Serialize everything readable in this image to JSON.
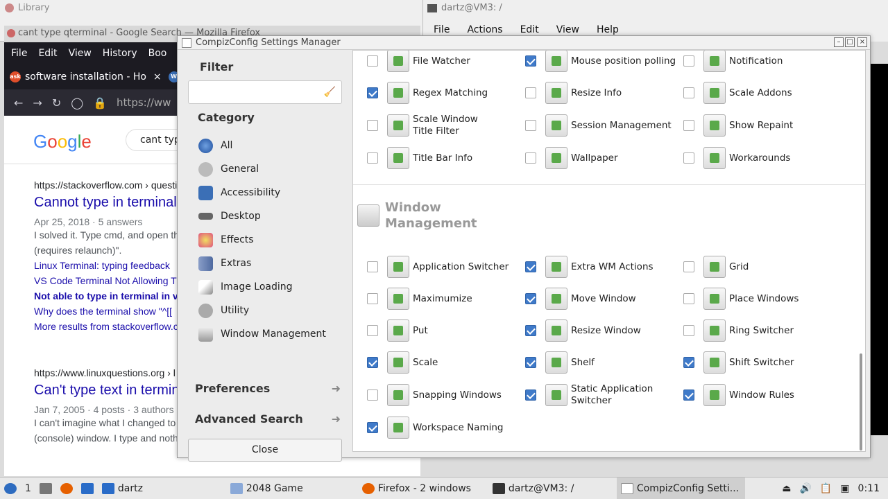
{
  "library": {
    "title": "Library"
  },
  "firefox": {
    "window_title": "cant type qterminal - Google Search — Mozilla Firefox",
    "menu": [
      "File",
      "Edit",
      "View",
      "History",
      "Boo"
    ],
    "tabs": [
      {
        "label": "software installation - Ho",
        "close": "×"
      },
      {
        "label": ""
      }
    ],
    "url": "https://ww",
    "search_query": "cant type",
    "results": [
      {
        "url": "https://stackoverflow.com › questi",
        "title": "Cannot type in terminal",
        "meta": "Apr 25, 2018 · 5 answers",
        "snippet1": "I solved it. Type cmd, and open th",
        "snippet2": "(requires relaunch)\".",
        "links": [
          "Linux Terminal: typing feedback",
          "VS Code Terminal Not Allowing T",
          "Not able to type in terminal in v",
          "Why does the terminal show \"^[[",
          "More results from stackoverflow.c"
        ]
      },
      {
        "url": "https://www.linuxquestions.org › l",
        "title": "Can't type text in termin",
        "meta": "Jan 7, 2005 · 4 posts · 3 authors",
        "snippet1": "I can't imagine what I changed to",
        "snippet2": "(console) window. I type and noth"
      }
    ]
  },
  "terminal": {
    "title": "dartz@VM3: /",
    "menu": [
      "File",
      "Actions",
      "Edit",
      "View",
      "Help"
    ]
  },
  "compiz": {
    "title": "CompizConfig Settings Manager",
    "filter_label": "Filter",
    "filter_value": "",
    "category_label": "Category",
    "categories": [
      "All",
      "General",
      "Accessibility",
      "Desktop",
      "Effects",
      "Extras",
      "Image Loading",
      "Utility",
      "Window Management"
    ],
    "preferences_label": "Preferences",
    "advanced_search_label": "Advanced Search",
    "close_label": "Close",
    "top_plugins": [
      {
        "name": "File Watcher",
        "checked": false
      },
      {
        "name": "Mouse position polling",
        "checked": true
      },
      {
        "name": "Notification",
        "checked": false
      },
      {
        "name": "Regex Matching",
        "checked": true
      },
      {
        "name": "Resize Info",
        "checked": false
      },
      {
        "name": "Scale Addons",
        "checked": false
      },
      {
        "name": "Scale Window Title Filter",
        "checked": false
      },
      {
        "name": "Session Management",
        "checked": false
      },
      {
        "name": "Show Repaint",
        "checked": false
      },
      {
        "name": "Title Bar Info",
        "checked": false
      },
      {
        "name": "Wallpaper",
        "checked": false
      },
      {
        "name": "Workarounds",
        "checked": false
      }
    ],
    "wm_section_title": "Window Management",
    "wm_plugins": [
      {
        "name": "Application Switcher",
        "checked": false
      },
      {
        "name": "Extra WM Actions",
        "checked": true
      },
      {
        "name": "Grid",
        "checked": false
      },
      {
        "name": "Maximumize",
        "checked": false
      },
      {
        "name": "Move Window",
        "checked": true
      },
      {
        "name": "Place Windows",
        "checked": false
      },
      {
        "name": "Put",
        "checked": false
      },
      {
        "name": "Resize Window",
        "checked": true
      },
      {
        "name": "Ring Switcher",
        "checked": false
      },
      {
        "name": "Scale",
        "checked": true
      },
      {
        "name": "Shelf",
        "checked": true
      },
      {
        "name": "Shift Switcher",
        "checked": true
      },
      {
        "name": "Snapping Windows",
        "checked": false
      },
      {
        "name": "Static Application Switcher",
        "checked": true
      },
      {
        "name": "Window Rules",
        "checked": true
      },
      {
        "name": "Workspace Naming",
        "checked": true
      }
    ]
  },
  "taskbar": {
    "workspace": "1",
    "items": [
      "dartz",
      "2048 Game",
      "Firefox - 2 windows",
      "dartz@VM3: /",
      "CompizConfig Setti..."
    ],
    "clock": "0:11"
  }
}
